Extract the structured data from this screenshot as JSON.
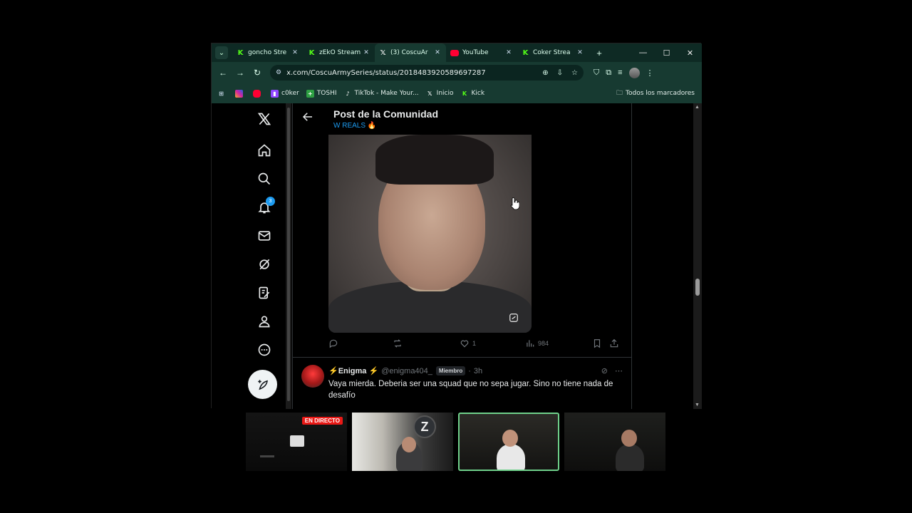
{
  "browser": {
    "tabs": [
      {
        "title": "goncho Stre",
        "icon": "kick"
      },
      {
        "title": "zEkO Stream",
        "icon": "kick"
      },
      {
        "title": "(3) CoscuAr",
        "icon": "x",
        "active": true
      },
      {
        "title": "YouTube",
        "icon": "youtube"
      },
      {
        "title": "Coker Strea",
        "icon": "kick"
      }
    ],
    "url": "x.com/CoscuArmySeries/status/2018483920589697287",
    "bookmarks": [
      {
        "label": "",
        "icon": "instagram"
      },
      {
        "label": "",
        "icon": "youtube"
      },
      {
        "label": "c0ker",
        "icon": "twitch"
      },
      {
        "label": "TOSHI",
        "icon": "plus-green"
      },
      {
        "label": "TikTok - Make Your...",
        "icon": "tiktok"
      },
      {
        "label": "Inicio",
        "icon": "x"
      },
      {
        "label": "Kick",
        "icon": "kick"
      }
    ],
    "all_bookmarks": "Todos los marcadores"
  },
  "x": {
    "notifications_count": "3",
    "header": {
      "title": "Post de la Comunidad",
      "subtitle": "W REALS 🔥"
    },
    "post": {
      "likes": "1",
      "views": "984"
    },
    "reply": {
      "name": "⚡Enigma ⚡",
      "handle": "@enigma404_",
      "badge": "Miembro",
      "separator": "·",
      "time": "3h",
      "text": "Vaya mierda. Deberia ser una squad que no sepa jugar. Sino no tiene nada de desafío"
    }
  },
  "streams": {
    "live_label": "EN DIRECTO",
    "logo_letter": "Z"
  },
  "colors": {
    "tab_bg": "#0e2a24",
    "toolbar_bg": "#173a31",
    "x_blue": "#1d9bf0",
    "kick_green": "#53fc18"
  }
}
